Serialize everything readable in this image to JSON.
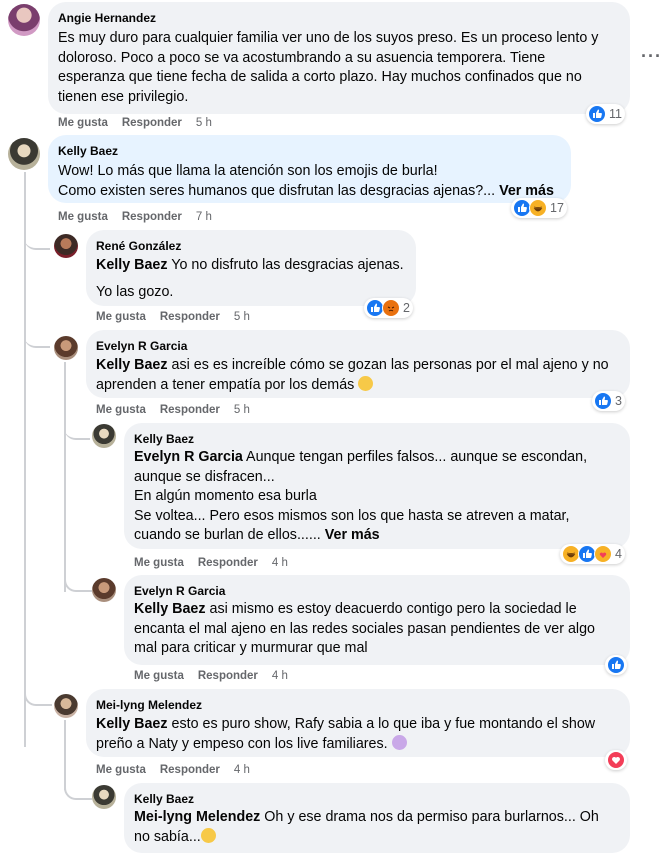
{
  "actions": {
    "like": "Me gusta",
    "reply": "Responder"
  },
  "comments": [
    {
      "author": "Angie Hernandez",
      "lines": [
        "Es muy duro para cualquier familia ver uno de los suyos preso. Es un proceso lento y",
        "doloroso. Poco a poco se va acostumbrando a su asuencia temporera. Tiene",
        "esperanza que tiene fecha de salida a corto plazo. Hay muchos confinados que no",
        "tienen ese privilegio."
      ],
      "time": "5 h",
      "reaction_count": "11",
      "reactions": [
        "like"
      ]
    },
    {
      "author": "Kelly Baez",
      "lines": [
        "Wow! Lo más que llama la atención son los emojis de burla!",
        "Como existen seres humanos que disfrutan las desgracias ajenas?..."
      ],
      "see_more": "Ver más",
      "time": "7 h",
      "reaction_count": "17",
      "reactions": [
        "like",
        "haha"
      ]
    },
    {
      "author": "René González",
      "mention": "Kelly Baez",
      "line1_rest": " Yo no disfruto las desgracias ajenas.",
      "line2": "Yo las gozo.",
      "time": "5 h",
      "reaction_count": "2",
      "reactions": [
        "like",
        "angry"
      ]
    },
    {
      "author": "Evelyn R Garcia",
      "mention": "Kelly Baez",
      "line1_rest": " asi es es increíble cómo se gozan las personas por el mal ajeno y no",
      "line2": "aprenden a tener empatía por los demás",
      "emoji": "pensive-emoji",
      "time": "5 h",
      "reaction_count": "3",
      "reactions": [
        "like"
      ]
    },
    {
      "author": "Kelly Baez",
      "mention": "Evelyn R Garcia",
      "line1_rest": " Aunque tengan perfiles falsos... aunque se escondan,",
      "lines": [
        "aunque se disfracen...",
        "En algún momento esa burla",
        "Se voltea... Pero esos mismos son los que hasta se atreven a matar,",
        "cuando se burlan de ellos......"
      ],
      "see_more": "Ver más",
      "time": "4 h",
      "reaction_count": "4",
      "reactions": [
        "haha",
        "like",
        "care"
      ]
    },
    {
      "author": "Evelyn R Garcia",
      "mention": "Kelly Baez",
      "line1_rest": " asi mismo es estoy deacuerdo contigo pero la sociedad le",
      "lines": [
        "encanta el mal ajeno en las redes sociales pasan pendientes de ver algo",
        "mal para criticar y murmurar que mal"
      ],
      "time": "4 h",
      "reactions": [
        "like"
      ]
    },
    {
      "author": "Mei-lyng Melendez",
      "mention": "Kelly Baez",
      "line1_rest": " esto es puro show, Rafy sabia a lo que iba y fue montando el show",
      "line2": "preño a Naty y empeso con los live familiares.",
      "emoji": "person-gesturing-emoji",
      "time": "4 h",
      "reactions": [
        "love"
      ]
    },
    {
      "author": "Kelly Baez",
      "mention": "Mei-lyng Melendez",
      "line1_rest": " Oh y ese drama nos da permiso para burlarnos... Oh",
      "line2": "no sabía...",
      "emoji": "upside-down-emoji"
    }
  ],
  "colors": {
    "bubble": "#f0f2f5",
    "highlight_bubble": "#e7f3ff",
    "like": "#1877f2",
    "love": "#f33e58",
    "haha": "#f7b125",
    "meta": "#65676b"
  }
}
